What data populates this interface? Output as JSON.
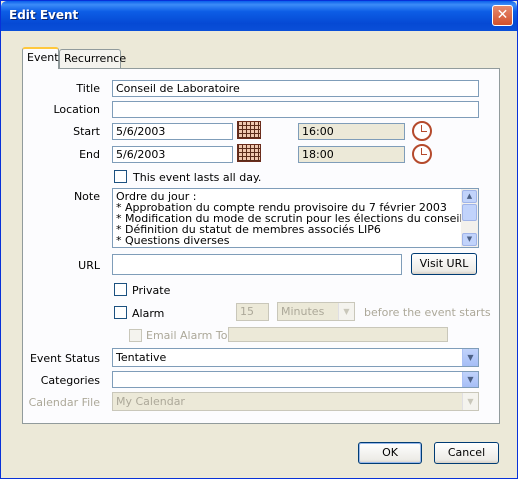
{
  "window": {
    "title": "Edit Event",
    "close_glyph": "✕"
  },
  "tabs": [
    {
      "label": "Event"
    },
    {
      "label": "Recurrence"
    }
  ],
  "form": {
    "title_label": "Title",
    "title_value": "Conseil de Laboratoire",
    "location_label": "Location",
    "location_value": "",
    "start_label": "Start",
    "start_date": "5/6/2003",
    "start_time": "16:00",
    "end_label": "End",
    "end_date": "5/6/2003",
    "end_time": "18:00",
    "all_day_label": "This event lasts all day.",
    "note_label": "Note",
    "note_lines": [
      "Ordre du  jour :",
      "* Approbation du compte rendu provisoire du 7 février 2003",
      "* Modification du mode de scrutin pour les élections du conseil de labo",
      "* Définition du statut de membres associés LIP6",
      "* Questions diverses"
    ],
    "url_label": "URL",
    "url_value": "",
    "visit_url_label": "Visit URL",
    "private_label": "Private",
    "alarm_label": "Alarm",
    "alarm_value": "15",
    "alarm_unit": "Minutes",
    "alarm_suffix": "before the event starts",
    "email_alarm_label": "Email Alarm To",
    "email_alarm_value": "",
    "status_label": "Event Status",
    "status_value": "Tentative",
    "categories_label": "Categories",
    "categories_value": "",
    "calendar_file_label": "Calendar File",
    "calendar_file_value": "My Calendar"
  },
  "buttons": {
    "ok_label": "OK",
    "cancel_label": "Cancel"
  },
  "icons": {
    "dropdown": "▼",
    "scroll_up": "▲",
    "scroll_down": "▼"
  },
  "colors": {
    "titlebar": "#0A4FD8",
    "window_bg": "#ECE9D8",
    "field_border": "#7F9DB9"
  }
}
